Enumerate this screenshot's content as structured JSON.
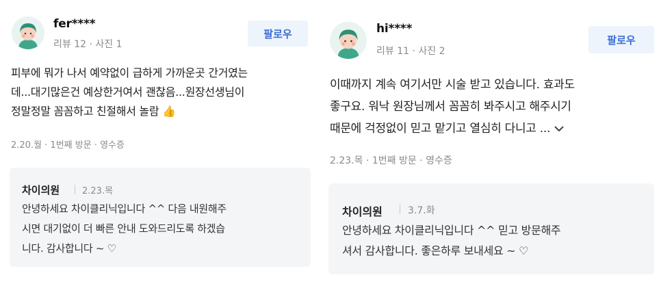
{
  "reviews": [
    {
      "user": {
        "name": "fer****",
        "meta": "리뷰 12 · 사진 1"
      },
      "follow_label": "팔로우",
      "text_lines": [
        "피부에 뭐가 나서 예약없이 급하게 가까운곳 간거였는",
        "데...대기많은건 예상한거여서 괜찮음...원장선생님이",
        "정말정말 꼼꼼하고 친절해서 놀람 👍"
      ],
      "visit_meta": "2.20.월 · 1번째 방문 · 영수증",
      "reply": {
        "name": "차이의원",
        "date": "2.23.목",
        "lines": [
          "안녕하세요 차이클리닉입니다 ^^ 다음 내원해주",
          "시면 대기없이 더 빠른 안내 도와드리도록 하겠습",
          "니다. 감사합니다 ~ ♡"
        ]
      }
    },
    {
      "user": {
        "name": "hi****",
        "meta": "리뷰 11 · 사진 2"
      },
      "follow_label": "팔로우",
      "text_lines": [
        "이때까지 계속 여기서만 시술 받고 있습니다. 효과도",
        "좋구요. 워낙 원장님께서 꼼꼼히 봐주시고 해주시기",
        "때문에 걱정없이 믿고 맡기고 열심히 다니고 ..."
      ],
      "visit_meta": "2.23.목 · 1번째 방문 · 영수증",
      "reply": {
        "name": "차이의원",
        "date": "3.7.화",
        "lines": [
          "안녕하세요 차이클리닉입니다 ^^ 믿고 방문해주",
          "셔서 감사합니다. 좋은하루 보내세요 ~ ♡"
        ]
      }
    }
  ],
  "icons": {
    "avatar": "user-avatar-icon",
    "expand": "chevron-down-icon"
  },
  "colors": {
    "follow_bg": "#eef4fc",
    "follow_text": "#3d6fd8",
    "reply_bg": "#f4f5f6",
    "avatar_bg": "#e9f4f1"
  }
}
